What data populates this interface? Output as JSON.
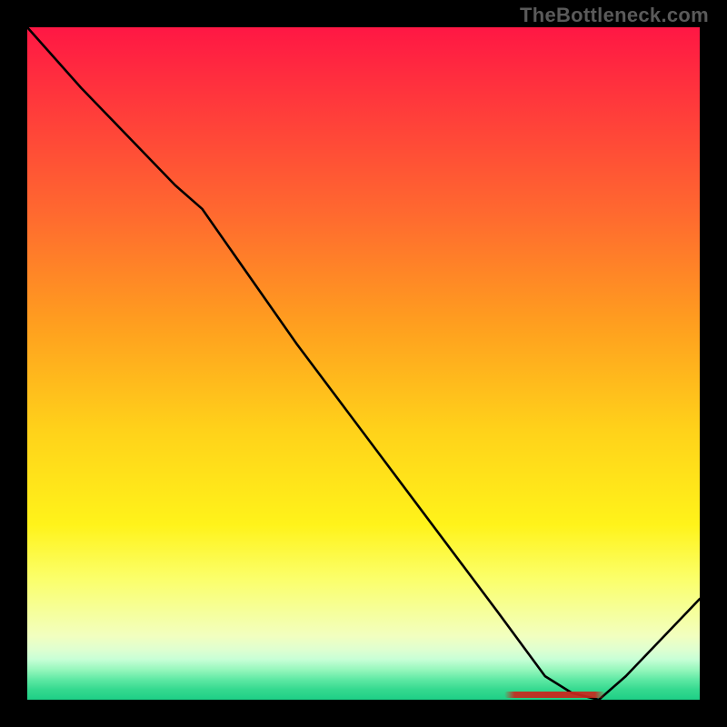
{
  "watermark": "TheBottleneck.com",
  "chart_data": {
    "type": "line",
    "title": "",
    "xlabel": "",
    "ylabel": "",
    "xlim": [
      0,
      100
    ],
    "ylim": [
      0,
      100
    ],
    "background_gradient": {
      "top": "#ff1744",
      "middle": "#ffd21a",
      "bottom": "#1ecf86"
    },
    "series": [
      {
        "name": "bottleneck-curve",
        "x": [
          0,
          8,
          22,
          26,
          40,
          55,
          70,
          77,
          81,
          85,
          89,
          100
        ],
        "values": [
          100,
          91,
          76.5,
          73,
          53,
          33,
          13,
          3.5,
          1,
          0,
          3.5,
          15
        ]
      }
    ],
    "highlight_range": {
      "name": "optimal-region",
      "x_start": 71,
      "x_end": 86,
      "color": "#b83224"
    }
  }
}
